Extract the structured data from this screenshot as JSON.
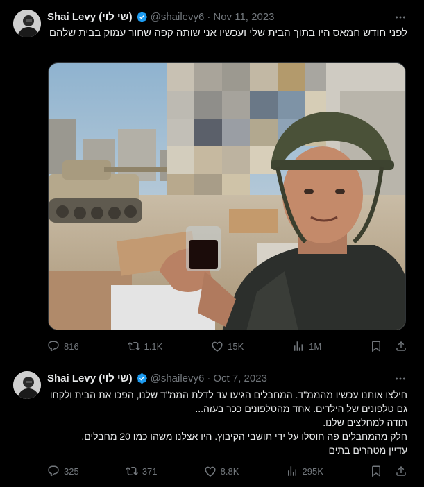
{
  "tweets": [
    {
      "author_name": "Shai Levy (שי לוי)",
      "handle": "@shailevy6",
      "separator": "·",
      "date": "Nov 11, 2023",
      "text": "לפני חודש חמאס היו בתוך הבית שלי ועכשיו אני שותה קפה שחור עמוק בבית שלהם",
      "metrics": {
        "replies": "816",
        "reposts": "1.1K",
        "likes": "15K",
        "views": "1M"
      }
    },
    {
      "author_name": "Shai Levy (שי לוי)",
      "handle": "@shailevy6",
      "separator": "·",
      "date": "Oct 7, 2023",
      "text_lines": [
        "חילצו אותנו עכשיו מהממ\"ד. המחבלים הגיעו עד לדלת הממ\"ד שלנו, הפכו את הבית ולקחו גם טלפונים של הילדים. אחד מהטלפונים ככר בעזה...",
        "תודה למחלצים שלנו.",
        "חלק מהמחבלים פה חוסלו על ידי תושבי הקיבוץ. היו אצלנו משהו כמו 20 מחבלים.",
        "עדיין מטהרים בתים"
      ],
      "metrics": {
        "replies": "325",
        "reposts": "371",
        "likes": "8.8K",
        "views": "295K"
      }
    }
  ],
  "colors": {
    "background": "#000000",
    "text": "#e7e9ea",
    "muted": "#71767b",
    "verified": "#1d9bf0",
    "divider": "#2f3336"
  },
  "icons": [
    "more-icon",
    "verified-badge-icon",
    "reply-icon",
    "repost-icon",
    "like-icon",
    "views-icon",
    "bookmark-icon",
    "share-icon"
  ]
}
